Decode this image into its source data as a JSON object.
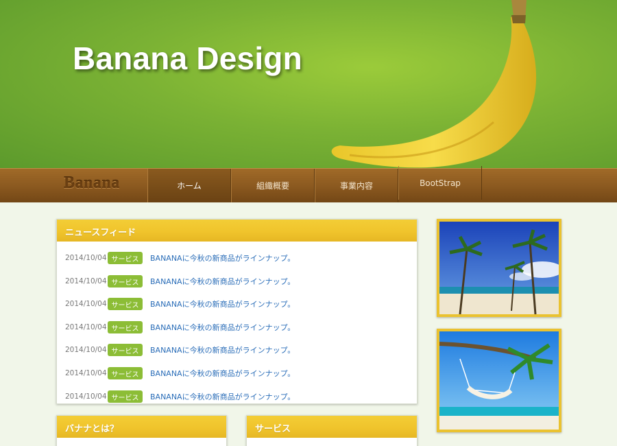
{
  "hero": {
    "title": "Banana Design"
  },
  "nav": {
    "logo": "Banana",
    "items": [
      {
        "label": "ホーム",
        "active": true
      },
      {
        "label": "組織概要",
        "active": false
      },
      {
        "label": "事業内容",
        "active": false
      },
      {
        "label": "BootStrap",
        "active": false
      }
    ]
  },
  "news": {
    "title": "ニュースフィード",
    "rows": [
      {
        "date": "2014/10/04",
        "tag": "サービス",
        "text": "BANANAに今秋の新商品がラインナップ。"
      },
      {
        "date": "2014/10/04",
        "tag": "サービス",
        "text": "BANANAに今秋の新商品がラインナップ。"
      },
      {
        "date": "2014/10/04",
        "tag": "サービス",
        "text": "BANANAに今秋の新商品がラインナップ。"
      },
      {
        "date": "2014/10/04",
        "tag": "サービス",
        "text": "BANANAに今秋の新商品がラインナップ。"
      },
      {
        "date": "2014/10/04",
        "tag": "サービス",
        "text": "BANANAに今秋の新商品がラインナップ。"
      },
      {
        "date": "2014/10/04",
        "tag": "サービス",
        "text": "BANANAに今秋の新商品がラインナップ。"
      },
      {
        "date": "2014/10/04",
        "tag": "サービス",
        "text": "BANANAに今秋の新商品がラインナップ。"
      }
    ]
  },
  "panels": {
    "about_title": "バナナとは？",
    "service_title": "サービス"
  },
  "colors": {
    "accent": "#f0c42c",
    "tag": "#8cbd36",
    "link": "#2a6db8",
    "nav": "#8c5a20",
    "hero": "#7bb234"
  }
}
